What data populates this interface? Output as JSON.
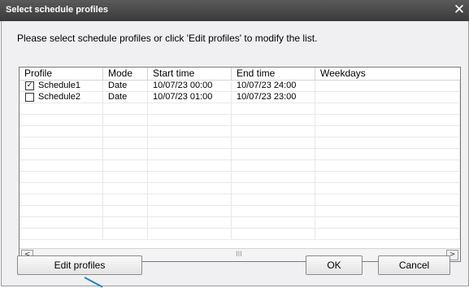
{
  "window": {
    "title": "Select schedule profiles",
    "close_glyph": "✕"
  },
  "instruction": "Please select schedule profiles or click 'Edit profiles' to modify the list.",
  "table": {
    "columns": [
      "Profile",
      "Mode",
      "Start time",
      "End time",
      "Weekdays"
    ],
    "rows": [
      {
        "checked": true,
        "profile": "Schedule1",
        "mode": "Date",
        "start": "10/07/23 00:00",
        "end": "10/07/23 24:00",
        "weekdays": ""
      },
      {
        "checked": false,
        "profile": "Schedule2",
        "mode": "Date",
        "start": "10/07/23 01:00",
        "end": "10/07/23 23:00",
        "weekdays": ""
      }
    ],
    "empty_rows": 12
  },
  "scrollbar": {
    "left_arrow": "<",
    "right_arrow": ">",
    "grip": "III"
  },
  "buttons": {
    "edit_profiles": "Edit profiles",
    "ok": "OK",
    "cancel": "Cancel"
  },
  "colors": {
    "titlebar": "#3f3f3f",
    "dialog_bg": "#f0eff2",
    "pointer_line": "#1f83c7"
  }
}
